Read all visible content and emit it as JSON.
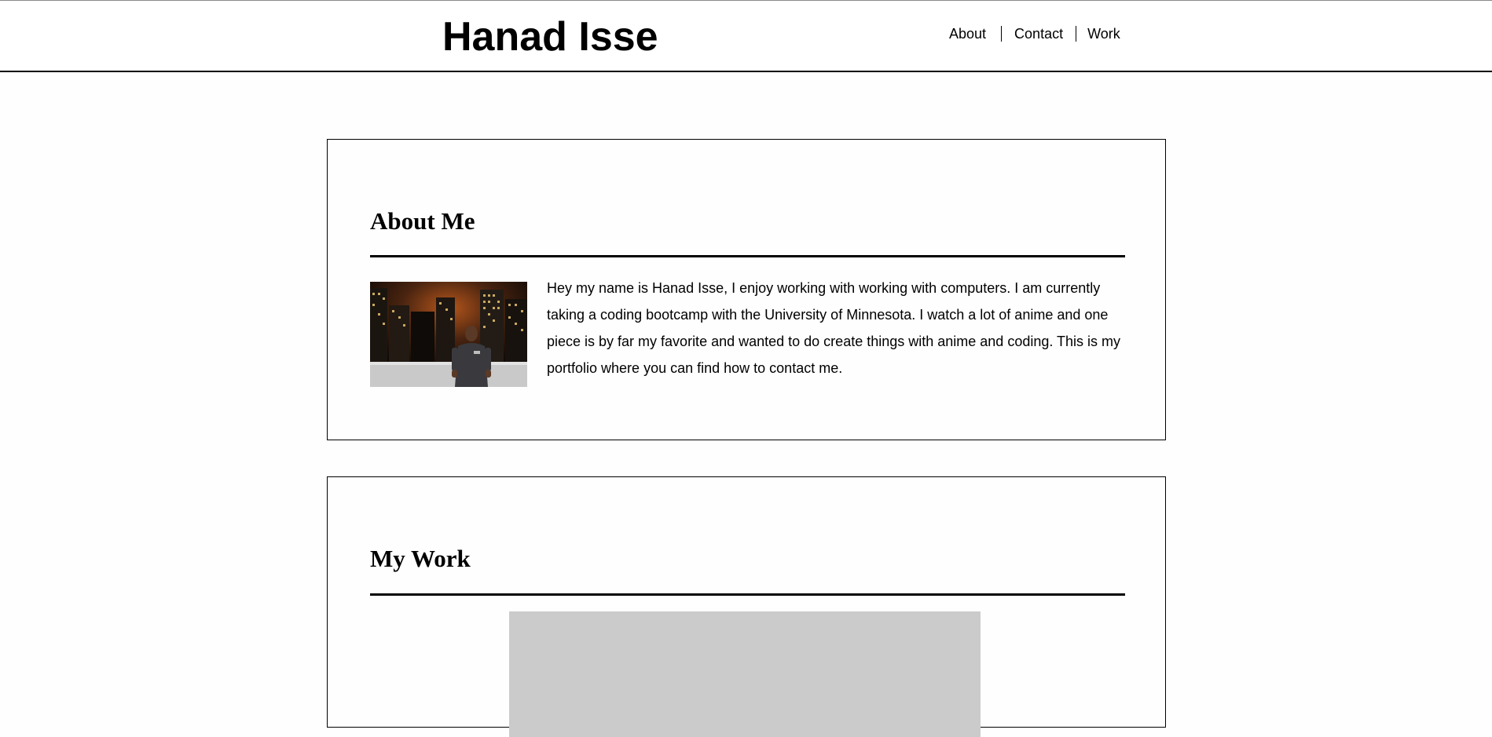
{
  "header": {
    "title": "Hanad Isse",
    "nav": [
      {
        "label": "About"
      },
      {
        "label": "Contact"
      },
      {
        "label": "Work"
      }
    ]
  },
  "about": {
    "heading": "About Me",
    "photo_alt": "Photo of Hanad Isse",
    "text": "Hey my name is Hanad Isse, I enjoy working with working with computers. I am currently taking a coding bootcamp with the University of Minnesota. I watch a lot of anime and one piece is by far my favorite and wanted to do create things with anime and coding. This is my portfolio where you can find how to contact me."
  },
  "work": {
    "heading": "My Work"
  }
}
